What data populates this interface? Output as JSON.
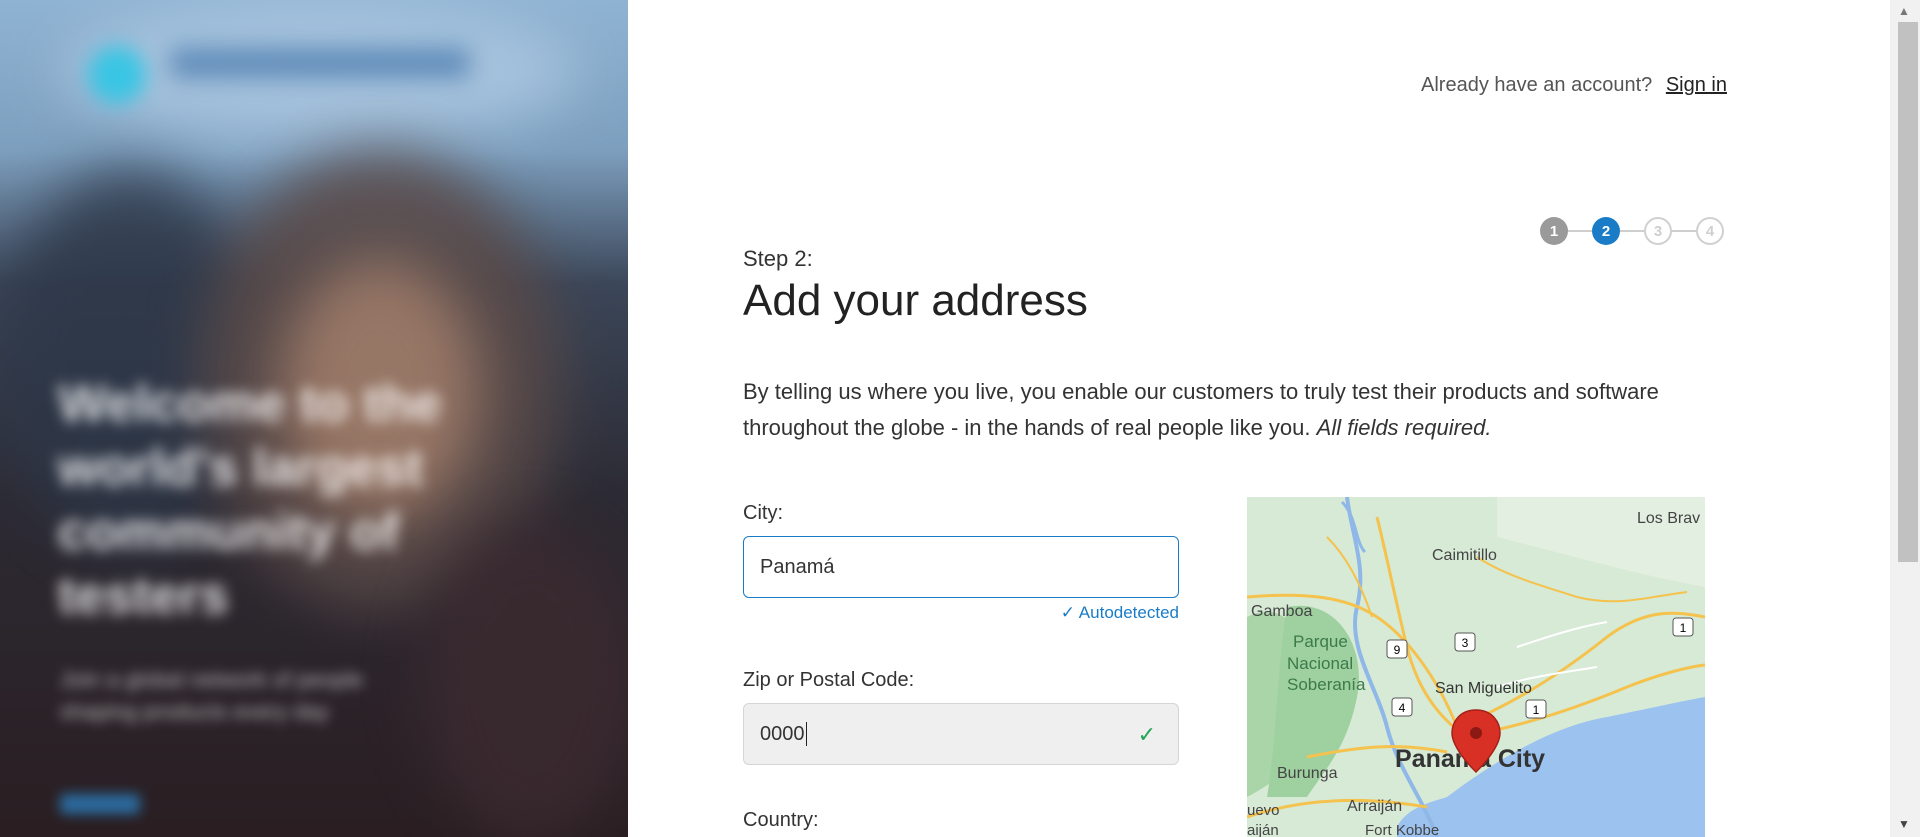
{
  "header": {
    "prompt": "Already have an account?",
    "signin_label": "Sign in"
  },
  "stepper": {
    "steps": [
      "1",
      "2",
      "3",
      "4"
    ],
    "current": 2
  },
  "content": {
    "step_label": "Step 2:",
    "title": "Add your address",
    "description": "By telling us where you live, you enable our customers to truly test their products and software throughout the globe - in the hands of real people like you.",
    "required_note": "All fields required."
  },
  "form": {
    "city_label": "City:",
    "city_value": "Panamá",
    "autodetected": "Autodetected",
    "zip_label": "Zip or Postal Code:",
    "zip_value": "0000",
    "country_label": "Country:"
  },
  "map": {
    "labels": [
      "Los Brav",
      "Caimitillo",
      "Gamboa",
      "Parque",
      "Nacional",
      "Soberanía",
      "San Miguelito",
      "Panama City",
      "Burunga",
      "Arraiján",
      "uevo",
      "aiján",
      "Fort Kobbe"
    ],
    "route_badges": [
      "9",
      "3",
      "1",
      "4",
      "1"
    ]
  },
  "colors": {
    "accent": "#1a7cc7",
    "success": "#23a455",
    "pin": "#d93025"
  }
}
